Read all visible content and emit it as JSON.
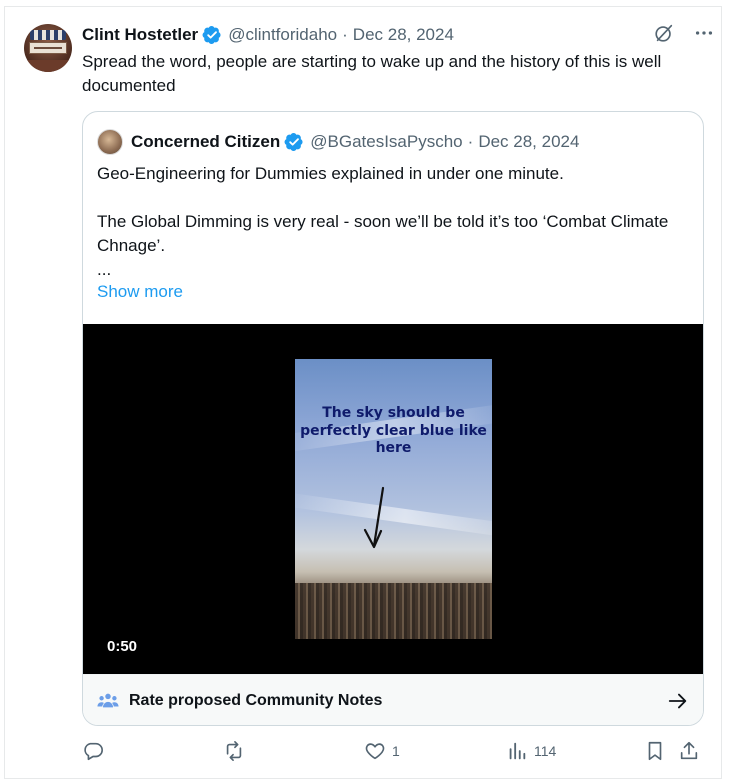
{
  "post": {
    "author_name": "Clint Hostetler",
    "handle": "@clintforidaho",
    "separator": "·",
    "date": "Dec 28, 2024",
    "text": "Spread the word, people are starting to wake up and the history of this is well documented",
    "verified_icon": "verified-badge-icon",
    "more_icon": "more-icon",
    "grok_icon": "grok-icon"
  },
  "quote": {
    "author_name": "Concerned Citizen",
    "handle": "@BGatesIsaPyscho",
    "separator": "·",
    "date": "Dec 28, 2024",
    "text": "Geo-Engineering for Dummies explained in under one minute.\n\nThe Global Dimming is very real - soon we’ll be told it’s too ‘Combat Climate Chnage’.\n...",
    "show_more": "Show more",
    "video": {
      "caption": "The sky should be perfectly clear blue like here",
      "duration": "0:50"
    },
    "community_notes": {
      "label": "Rate proposed Community Notes",
      "icon": "people-icon",
      "arrow_icon": "arrow-right-icon"
    }
  },
  "actions": {
    "reply_count": "",
    "repost_count": "",
    "like_count": "1",
    "views_count": "114"
  },
  "colors": {
    "accent": "#1d9bf0",
    "secondary_text": "#536471",
    "border": "#cfd9de"
  }
}
